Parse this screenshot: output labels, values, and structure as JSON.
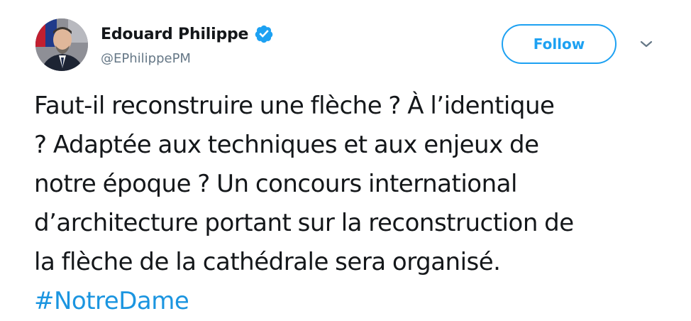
{
  "author": {
    "display_name": "Edouard Philippe",
    "handle": "@EPhilippePM",
    "verified": true,
    "avatar_icon": "profile-photo"
  },
  "actions": {
    "follow_label": "Follow",
    "more_icon": "chevron-down-icon"
  },
  "tweet": {
    "lines": [
      "Faut-il reconstruire une flèche ? À l’identique",
      "? Adaptée aux techniques et aux enjeux de",
      "notre époque ? Un concours international",
      "d’architecture portant sur la reconstruction de",
      "la flèche de la cathédrale sera organisé."
    ],
    "hashtag": "#NotreDame"
  },
  "colors": {
    "accent": "#1da1f2",
    "link": "#1b95e0",
    "text": "#14171a",
    "secondary": "#657786"
  }
}
